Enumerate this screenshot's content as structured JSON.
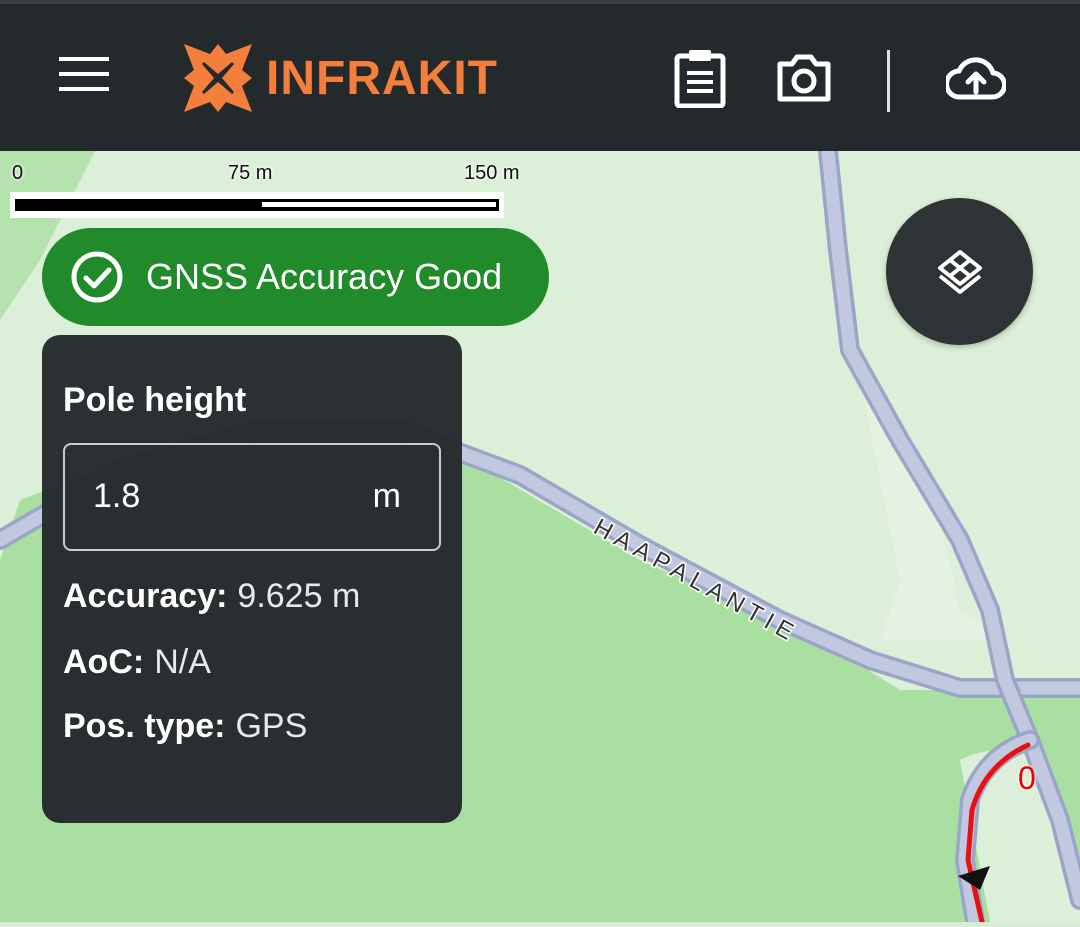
{
  "app": {
    "logo_text": "INFRAKIT",
    "brand_color": "#f47e3c"
  },
  "toolbar": {
    "menu_icon": "hamburger-menu-icon",
    "clipboard_icon": "clipboard-icon",
    "camera_icon": "camera-icon",
    "upload_icon": "cloud-upload-icon"
  },
  "scale_bar": {
    "labels": [
      "0",
      "75 m",
      "150 m"
    ]
  },
  "gnss_status": {
    "text": "GNSS Accuracy Good",
    "icon": "check-circle-icon",
    "color": "#218a2a"
  },
  "info_panel": {
    "title": "Pole height",
    "pole_height_value": "1.8",
    "pole_height_unit": "m",
    "rows": [
      {
        "label": "Accuracy:",
        "value": "9.625 m"
      },
      {
        "label": "AoC:",
        "value": "N/A"
      },
      {
        "label": "Pos. type:",
        "value": "GPS"
      }
    ]
  },
  "map": {
    "road_name": "HAAPALANTIE",
    "route_label": "0",
    "layers_icon": "layers-icon"
  }
}
